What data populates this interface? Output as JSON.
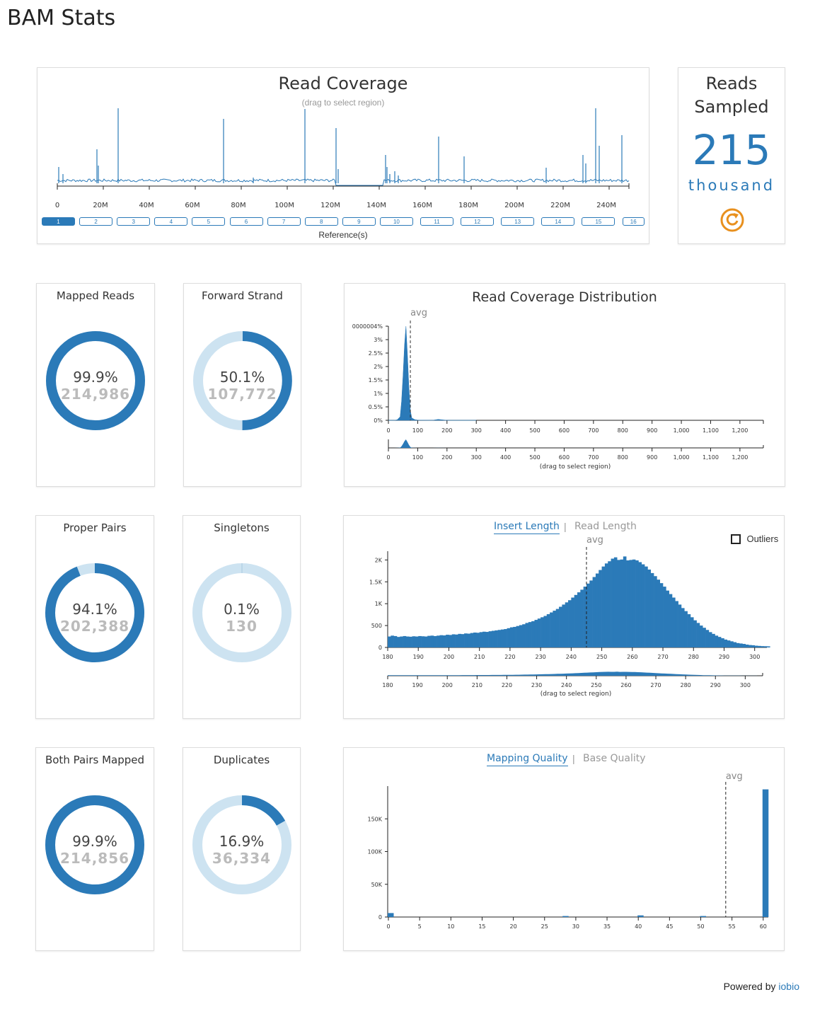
{
  "page_title": "BAM Stats",
  "coverage": {
    "title": "Read Coverage",
    "subtitle": "(drag to select region)",
    "x_ticks": [
      "0",
      "20M",
      "40M",
      "60M",
      "80M",
      "100M",
      "120M",
      "140M",
      "160M",
      "180M",
      "200M",
      "220M",
      "240M"
    ],
    "references_label": "Reference(s)",
    "references": [
      "1",
      "2",
      "3",
      "4",
      "5",
      "6",
      "7",
      "8",
      "9",
      "10",
      "11",
      "12",
      "13",
      "14",
      "15",
      "16"
    ]
  },
  "reads_sampled": {
    "title_line1": "Reads",
    "title_line2": "Sampled",
    "value": "215",
    "unit": "thousand",
    "refresh_icon": "refresh-icon"
  },
  "donuts": [
    {
      "id": "mapped-reads",
      "title": "Mapped Reads",
      "pct": "99.9%",
      "count": "214,986",
      "fraction": 0.999
    },
    {
      "id": "forward-strand",
      "title": "Forward Strand",
      "pct": "50.1%",
      "count": "107,772",
      "fraction": 0.501
    },
    {
      "id": "proper-pairs",
      "title": "Proper Pairs",
      "pct": "94.1%",
      "count": "202,388",
      "fraction": 0.941
    },
    {
      "id": "singletons",
      "title": "Singletons",
      "pct": "0.1%",
      "count": "130",
      "fraction": 0.001
    },
    {
      "id": "both-pairs-mapped",
      "title": "Both Pairs Mapped",
      "pct": "99.9%",
      "count": "214,856",
      "fraction": 0.999
    },
    {
      "id": "duplicates",
      "title": "Duplicates",
      "pct": "16.9%",
      "count": "36,334",
      "fraction": 0.169
    }
  ],
  "coverage_dist": {
    "title": "Read Coverage Distribution",
    "avg_label": "avg",
    "drag_label": "(drag to select region)"
  },
  "insert_panel": {
    "tab_active": "Insert Length",
    "tab_sep": "|",
    "tab_inactive": "Read Length",
    "outliers_label": "Outliers",
    "avg_label": "avg",
    "drag_label": "(drag to select region)"
  },
  "quality_panel": {
    "tab_active": "Mapping Quality",
    "tab_sep": "|",
    "tab_inactive": "Base Quality",
    "avg_label": "avg"
  },
  "footer": {
    "prefix": "Powered by",
    "link": "iobio"
  },
  "colors": {
    "accent": "#2b7ab8",
    "light": "#cde3f1",
    "refresh": "#e8901e"
  },
  "chart_data": [
    {
      "type": "area",
      "title": "Read Coverage Distribution",
      "x": [
        0,
        20,
        30,
        40,
        45,
        50,
        55,
        60,
        65,
        70,
        75,
        80,
        90,
        100,
        150,
        170,
        200,
        250,
        300
      ],
      "y": [
        0,
        0,
        0.02,
        0.15,
        0.8,
        1.9,
        3.2,
        4.0,
        2.8,
        1.4,
        0.4,
        0.1,
        0.03,
        0.01,
        0.0,
        0.04,
        0.0,
        0.0,
        0.0
      ],
      "y_ticks": [
        "0%",
        "0.5%",
        "1%",
        "1.5%",
        "2%",
        "2.5%",
        "3%",
        "0000004%"
      ],
      "x_ticks": [
        "0",
        "100",
        "200",
        "300",
        "400",
        "500",
        "600",
        "700",
        "800",
        "900",
        "1,000",
        "1,100",
        "1,200"
      ],
      "xlim": [
        0,
        1280
      ],
      "ylim": [
        0,
        0.04
      ],
      "avg": 75
    },
    {
      "type": "bar",
      "title": "Insert Length",
      "x_start": 180,
      "x_step": 1,
      "values": [
        250,
        270,
        260,
        240,
        250,
        260,
        250,
        245,
        255,
        250,
        260,
        255,
        250,
        265,
        270,
        260,
        270,
        280,
        275,
        290,
        285,
        300,
        295,
        310,
        305,
        320,
        315,
        330,
        340,
        335,
        350,
        360,
        355,
        370,
        380,
        390,
        400,
        410,
        420,
        440,
        460,
        470,
        490,
        510,
        530,
        560,
        580,
        600,
        630,
        660,
        690,
        720,
        760,
        800,
        840,
        880,
        930,
        980,
        1030,
        1080,
        1140,
        1200,
        1260,
        1320,
        1390,
        1460,
        1530,
        1610,
        1690,
        1770,
        1850,
        1920,
        1970,
        2030,
        2060,
        2000,
        2010,
        2080,
        1990,
        2000,
        2010,
        1990,
        1950,
        1900,
        1850,
        1780,
        1700,
        1630,
        1550,
        1470,
        1390,
        1300,
        1220,
        1140,
        1060,
        980,
        900,
        830,
        760,
        690,
        620,
        560,
        500,
        450,
        400,
        350,
        310,
        270,
        240,
        210,
        180,
        160,
        140,
        120,
        100,
        90,
        80,
        65,
        55,
        50,
        40,
        35,
        30,
        28,
        25
      ],
      "y_ticks": [
        "0",
        "500",
        "1K",
        "1.5K",
        "2K"
      ],
      "x_ticks": [
        "180",
        "190",
        "200",
        "210",
        "220",
        "230",
        "240",
        "250",
        "260",
        "270",
        "280",
        "290",
        "300"
      ],
      "xlim": [
        180,
        304
      ],
      "ylim": [
        0,
        2200
      ],
      "avg": 245
    },
    {
      "type": "bar",
      "title": "Mapping Quality",
      "x": [
        0,
        28,
        40,
        50,
        60
      ],
      "values": [
        6000,
        1500,
        2500,
        1500,
        195000
      ],
      "y_ticks": [
        "0",
        "50K",
        "100K",
        "150K"
      ],
      "x_ticks": [
        "0",
        "5",
        "10",
        "15",
        "20",
        "25",
        "30",
        "35",
        "40",
        "45",
        "50",
        "55",
        "60"
      ],
      "xlim": [
        0,
        61
      ],
      "ylim": [
        0,
        200000
      ],
      "avg": 54
    }
  ]
}
